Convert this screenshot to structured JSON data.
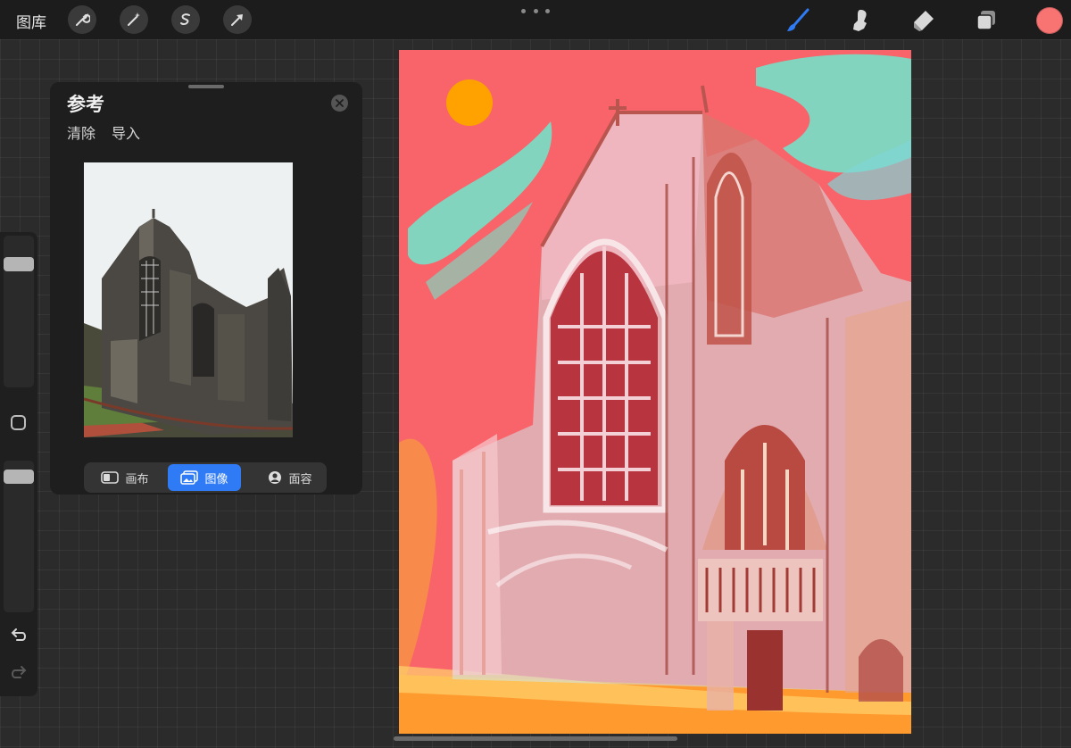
{
  "topbar": {
    "gallery_label": "图库",
    "tools_left": [
      "wrench-icon",
      "magic-wand-icon",
      "selection-icon",
      "transform-icon"
    ],
    "tools_right": [
      "brush-icon",
      "smudge-icon",
      "eraser-icon",
      "layers-icon"
    ],
    "current_color": "#f77472"
  },
  "reference_panel": {
    "title": "参考",
    "clear_label": "清除",
    "import_label": "导入",
    "tabs": [
      {
        "label": "画布",
        "icon": "canvas-icon",
        "active": false
      },
      {
        "label": "图像",
        "icon": "image-icon",
        "active": true
      },
      {
        "label": "面容",
        "icon": "face-icon",
        "active": false
      }
    ]
  },
  "colors": {
    "accent": "#2f7bf5",
    "canvas_background": "#f9636a",
    "sun": "#ffa200",
    "sky_streaks": "#6ee8cc"
  }
}
